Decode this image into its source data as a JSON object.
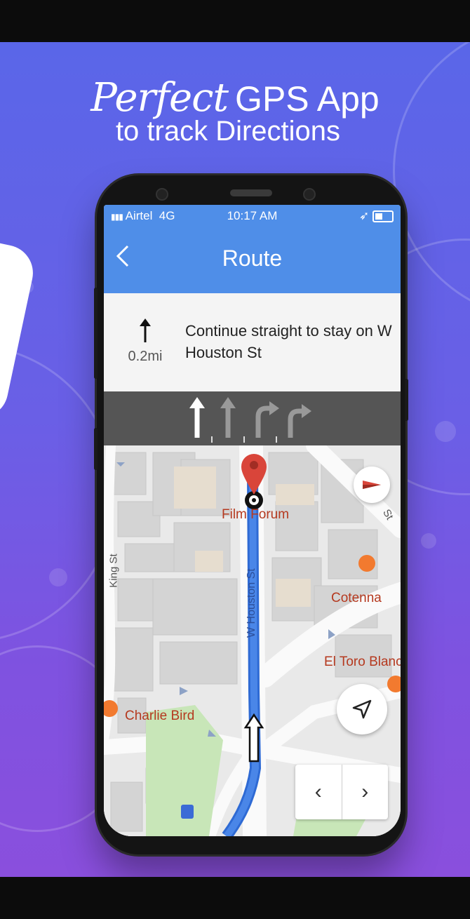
{
  "promo": {
    "headline_script": "Perfect",
    "headline_rest": "GPS App",
    "subheadline": "to track Directions"
  },
  "status_bar": {
    "carrier": "Airtel",
    "network": "4G",
    "time": "10:17 AM"
  },
  "header": {
    "back_icon": "chevron-left-icon",
    "title": "Route"
  },
  "instruction": {
    "icon": "arrow-up-icon",
    "distance": "0.2mi",
    "text": "Continue straight to stay on W Houston St"
  },
  "lanes": [
    {
      "type": "straight",
      "active": true
    },
    {
      "type": "straight",
      "active": false
    },
    {
      "type": "straight-right",
      "active": false
    },
    {
      "type": "right",
      "active": false
    }
  ],
  "map": {
    "places": {
      "film_forum": "Film Forum",
      "cotenna": "Cotenna",
      "el_toro": "El Toro Blanc",
      "charlie_bird": "Charlie Bird"
    },
    "streets": {
      "houston": "W Houston St",
      "king": "King St",
      "partial": "St"
    }
  },
  "controls": {
    "compass_icon": "compass-icon",
    "locate_icon": "navigation-arrow-icon",
    "prev_icon": "chevron-left-icon",
    "next_icon": "chevron-right-icon",
    "prev_label": "‹",
    "next_label": "›"
  },
  "colors": {
    "background_top": "#5a66e8",
    "background_bottom": "#8a4fdd",
    "header_blue": "#4f8ee8",
    "route_blue": "#4a86e8",
    "pin_red": "#d9453a",
    "place_text": "#b5391f"
  }
}
